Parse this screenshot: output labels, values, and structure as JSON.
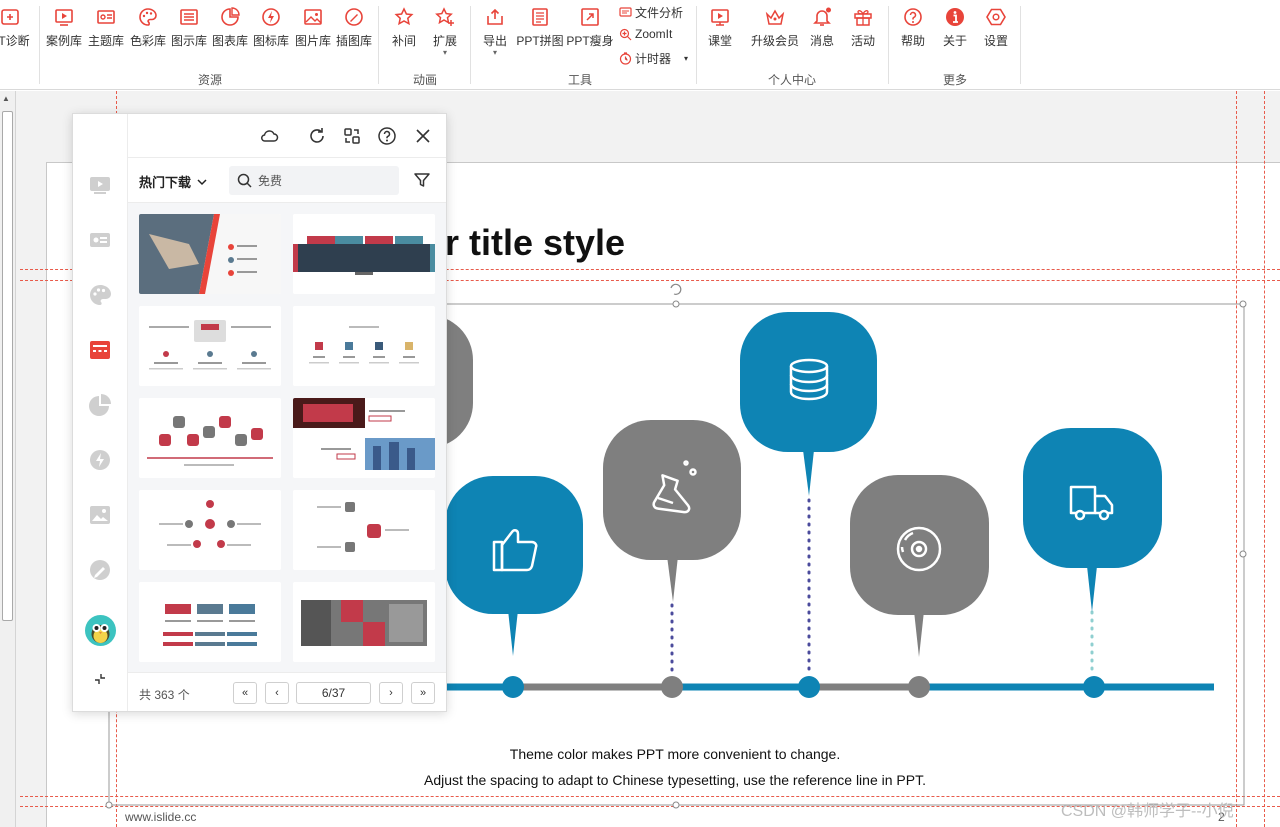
{
  "ribbon": {
    "buttons": [
      {
        "label": "PT诊断",
        "icon": "ppt-diagnose-icon"
      },
      {
        "label": "案例库",
        "icon": "case-library-icon"
      },
      {
        "label": "主题库",
        "icon": "theme-library-icon"
      },
      {
        "label": "色彩库",
        "icon": "palette-icon"
      },
      {
        "label": "图示库",
        "icon": "diagram-library-icon"
      },
      {
        "label": "图表库",
        "icon": "chart-library-icon"
      },
      {
        "label": "图标库",
        "icon": "icon-library-icon"
      },
      {
        "label": "图片库",
        "icon": "image-library-icon"
      },
      {
        "label": "插图库",
        "icon": "illustration-library-icon"
      },
      {
        "label": "补间",
        "icon": "star-icon"
      },
      {
        "label": "扩展",
        "icon": "star-extend-icon"
      },
      {
        "label": "导出",
        "icon": "export-icon"
      },
      {
        "label": "PPT拼图",
        "icon": "ppt-puzzle-icon"
      },
      {
        "label": "PPT瘦身",
        "icon": "ppt-slim-icon"
      },
      {
        "label": "课堂",
        "icon": "classroom-icon"
      },
      {
        "label": "升级会员",
        "icon": "crown-icon"
      },
      {
        "label": "消息",
        "icon": "bell-icon"
      },
      {
        "label": "活动",
        "icon": "gift-icon"
      },
      {
        "label": "帮助",
        "icon": "help-icon"
      },
      {
        "label": "关于",
        "icon": "info-icon"
      },
      {
        "label": "设置",
        "icon": "settings-icon"
      }
    ],
    "small": {
      "file_analysis": "文件分析",
      "zoomit": "ZoomIt",
      "timer": "计时器"
    },
    "groups": {
      "resources": "资源",
      "animation": "动画",
      "tools": "工具",
      "personal": "个人中心",
      "more": "更多"
    },
    "accent": "#e8443a"
  },
  "slide": {
    "title": "r title style",
    "caption_1": "Theme color makes PPT more convenient to change.",
    "caption_2": "Adjust the spacing to adapt to Chinese typesetting, use the reference line in PPT.",
    "footer_url": "www.islide.cc",
    "page_number": "2",
    "colors": {
      "blue": "#0e84b4",
      "gray": "#7f7f7f",
      "dots": "#4b4b9c",
      "dots_light": "#8fcfd0"
    }
  },
  "watermark": "CSDN @韩师学子--小倪",
  "panel": {
    "dropdown_label": "热门下载",
    "search_placeholder": "免费",
    "total_label": "共 363 个",
    "page_value": "6/37",
    "side_icons": [
      "slideshow-icon",
      "id-card-icon",
      "palette-icon",
      "layout-icon",
      "pie-chart-icon",
      "bolt-icon",
      "image-icon",
      "brush-icon",
      "avatar",
      "collapse-icon"
    ],
    "top_icons": [
      "cloud-icon",
      "refresh-icon",
      "swap-icon",
      "help-icon",
      "close-icon"
    ]
  }
}
